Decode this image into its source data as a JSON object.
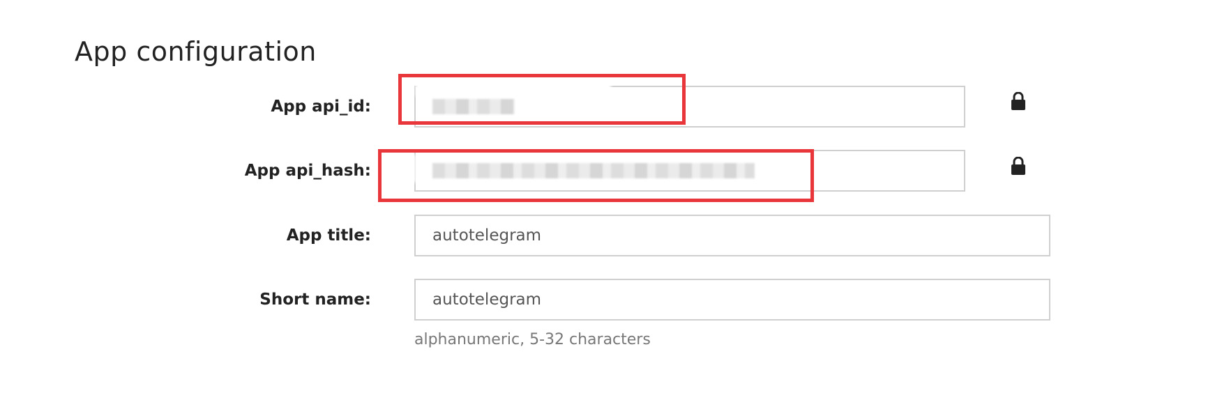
{
  "page": {
    "title": "App configuration"
  },
  "form": {
    "api_id": {
      "label": "App api_id:",
      "value_redacted": true,
      "icon": "lock-icon"
    },
    "api_hash": {
      "label": "App api_hash:",
      "value_redacted": true,
      "icon": "lock-icon"
    },
    "app_title": {
      "label": "App title:",
      "value": "autotelegram"
    },
    "short_name": {
      "label": "Short name:",
      "value": "autotelegram",
      "hint": "alphanumeric, 5-32 characters"
    }
  },
  "colors": {
    "highlight_border": "#e8363b",
    "input_border": "#cfcfcf",
    "hint_text": "#777777"
  }
}
